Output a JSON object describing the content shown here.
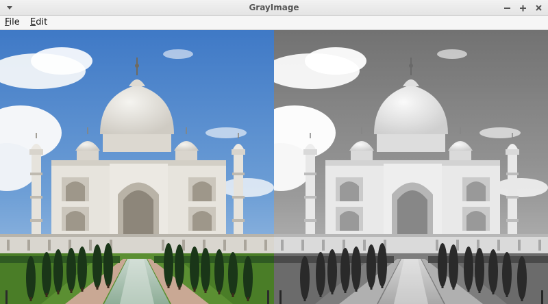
{
  "window": {
    "title": "GrayImage",
    "controls": [
      "window-menu-icon",
      "minimize-icon",
      "maximize-icon",
      "close-icon"
    ]
  },
  "menubar": {
    "items": [
      {
        "mnemonic": "F",
        "rest": "ile"
      },
      {
        "mnemonic": "E",
        "rest": "dit"
      }
    ]
  },
  "images": {
    "left": {
      "kind": "original-color-photo",
      "subject": "taj-mahal"
    },
    "right": {
      "kind": "grayscale-conversion",
      "subject": "taj-mahal"
    }
  },
  "colors": {
    "sky": "#3e78c4",
    "sky_light": "#8fb4dc",
    "marble": "#e8e6e1",
    "marble_shade": "#c9c5bd",
    "lawn": "#4f8a2d",
    "cypress": "#1c3a1a",
    "water": "#a9c3b0"
  }
}
